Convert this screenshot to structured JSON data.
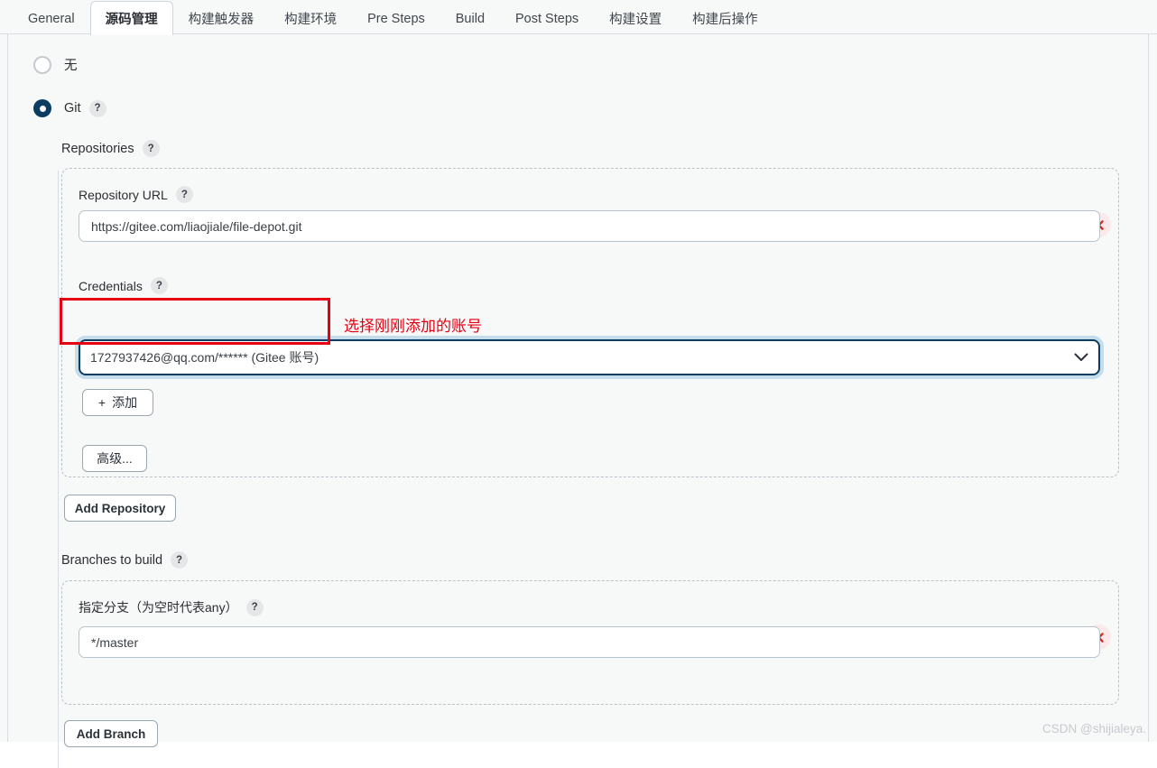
{
  "tabs": [
    {
      "label": "General",
      "active": false
    },
    {
      "label": "源码管理",
      "active": true
    },
    {
      "label": "构建触发器",
      "active": false
    },
    {
      "label": "构建环境",
      "active": false
    },
    {
      "label": "Pre Steps",
      "active": false
    },
    {
      "label": "Build",
      "active": false
    },
    {
      "label": "Post Steps",
      "active": false
    },
    {
      "label": "构建设置",
      "active": false
    },
    {
      "label": "构建后操作",
      "active": false
    }
  ],
  "scm": {
    "none_label": "无",
    "git_label": "Git",
    "help_glyph": "?"
  },
  "repositories": {
    "section_label": "Repositories",
    "url_label": "Repository URL",
    "url_value": "https://gitee.com/liaojiale/file-depot.git",
    "credentials_label": "Credentials",
    "credentials_value": "1727937426@qq.com/****** (Gitee 账号)",
    "add_credentials_label": "添加",
    "add_credentials_plus": "+",
    "advanced_label": "高级...",
    "add_repository_label": "Add Repository"
  },
  "branches": {
    "section_label": "Branches to build",
    "branch_label": "指定分支（为空时代表any）",
    "branch_value": "*/master",
    "add_branch_label": "Add Branch"
  },
  "annotation": {
    "note_text": "选择刚刚添加的账号",
    "color": "#e60012"
  },
  "watermark": {
    "text": "CSDN @shijialeya."
  },
  "colors": {
    "page_bg": "#f7f8f8",
    "accent_navy": "#0b3d62",
    "focus_halo": "#c5dcea",
    "delete_red": "#d93025"
  }
}
